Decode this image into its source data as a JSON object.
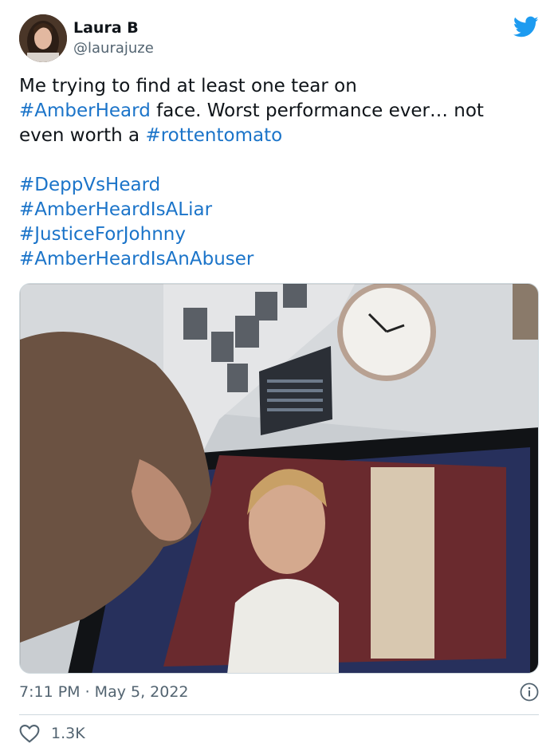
{
  "author": {
    "display_name": "Laura B",
    "handle": "@laurajuze"
  },
  "brand": {
    "logo_icon": "twitter-bird-icon",
    "accent_color": "#1d9bf0",
    "link_color": "#1b74c9"
  },
  "tweet": {
    "line1": "Me trying to find at least one tear on",
    "tag1": "#AmberHeard",
    "line2_rest": " face. Worst performance ever… not",
    "line3_start": "even worth a ",
    "tag2": "#rottentomato",
    "hashtags": [
      "#DeppVsHeard",
      "#AmberHeardIsALiar",
      "#JusticeForJohnny",
      "#AmberHeardIsAnAbuser"
    ]
  },
  "meta": {
    "timestamp": "7:11 PM · May 5, 2022",
    "info_icon": "info-icon"
  },
  "engagement": {
    "like_icon": "heart-icon",
    "likes": "1.3K"
  }
}
